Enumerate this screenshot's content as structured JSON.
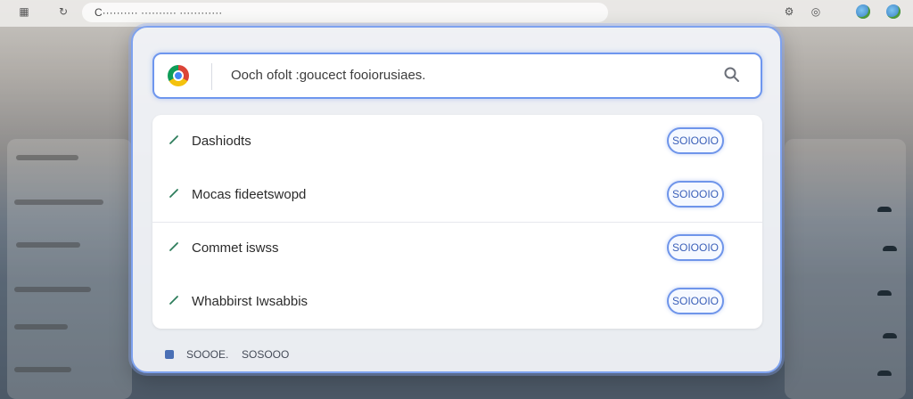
{
  "browser": {
    "url_text": "C·········· ·········· ············"
  },
  "modal": {
    "search": {
      "input_text": "Ooch ofolt :goucect fooiorusiaes."
    },
    "items": [
      {
        "label": "Dashiodts",
        "button_label": "SOIOOIO"
      },
      {
        "label": "Mocas fideetswopd",
        "button_label": "SOIOOIO"
      },
      {
        "label": "Commet iswss",
        "button_label": "SOIOOIO"
      },
      {
        "label": "Whabbirst Iwsabbis",
        "button_label": "SOIOOIO"
      }
    ],
    "footer": {
      "left_label": "SOOOE.",
      "right_label": "SOSOOO"
    }
  },
  "colors": {
    "accent": "#6e96ee",
    "pen_icon": "#2e7d5b"
  }
}
